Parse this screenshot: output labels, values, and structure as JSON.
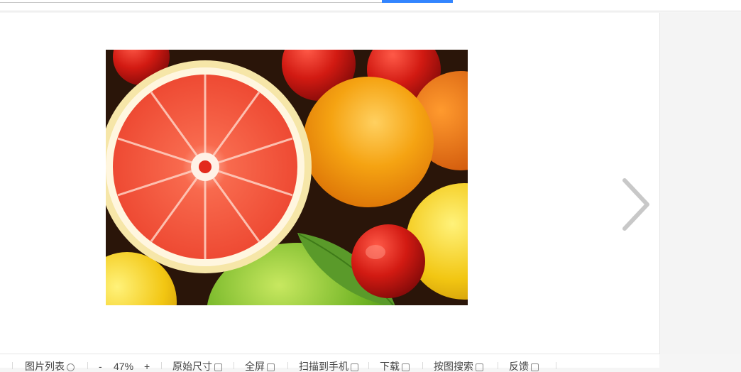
{
  "toolbar": {
    "image_list": "图片列表",
    "zoom_minus": "-",
    "zoom_level": "47%",
    "zoom_plus": "+",
    "original_size": "原始尺寸",
    "fullscreen": "全屏",
    "scan_to_phone": "扫描到手机",
    "download": "下载",
    "search_by_image": "按图搜索",
    "feedback": "反馈"
  },
  "colors": {
    "accent": "#3385ff",
    "arrow": "#c8c8c8"
  },
  "icons": [
    "chevron-right-icon"
  ]
}
